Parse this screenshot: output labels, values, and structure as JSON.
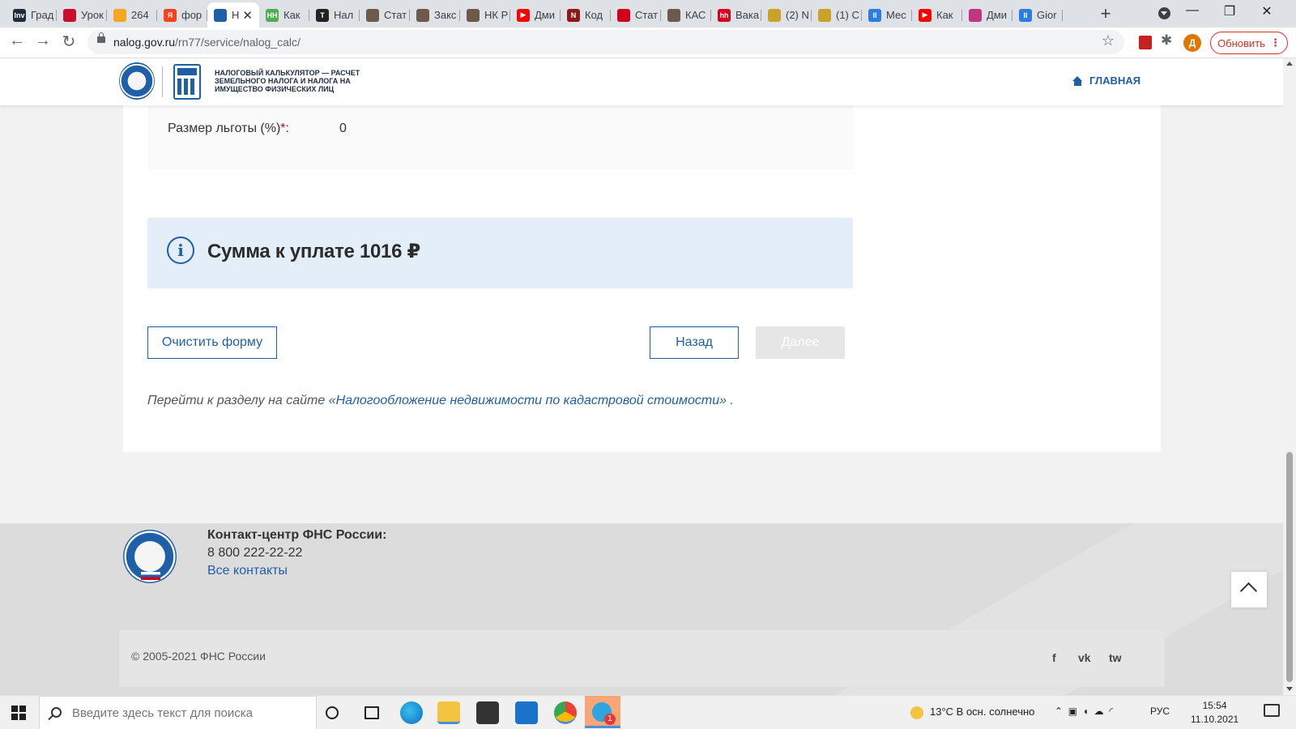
{
  "browser": {
    "tabs": [
      {
        "label": "Град",
        "favicon_text": "Inv",
        "color": "#1f2d3d"
      },
      {
        "label": "Урок",
        "favicon_text": "",
        "color": "#c8102e"
      },
      {
        "label": "264",
        "favicon_text": "",
        "color": "#f5a623"
      },
      {
        "label": "фор",
        "favicon_text": "Я",
        "color": "#fc3f1d"
      },
      {
        "label": "Н",
        "favicon_text": "",
        "color": "#1f5fa8"
      },
      {
        "label": "Как",
        "favicon_text": "HH",
        "color": "#4caf50"
      },
      {
        "label": "Нал",
        "favicon_text": "T",
        "color": "#222222"
      },
      {
        "label": "Стат",
        "favicon_text": "",
        "color": "#6e5a4b"
      },
      {
        "label": "Закс",
        "favicon_text": "",
        "color": "#6e5a4b"
      },
      {
        "label": "НК Р",
        "favicon_text": "",
        "color": "#6e5a4b"
      },
      {
        "label": "Дми",
        "favicon_text": "▶",
        "color": "#ff0000"
      },
      {
        "label": "Код",
        "favicon_text": "N",
        "color": "#8b1a1a"
      },
      {
        "label": "Стат",
        "favicon_text": "",
        "color": "#d0021b"
      },
      {
        "label": "КАС",
        "favicon_text": "",
        "color": "#6e5a4b"
      },
      {
        "label": "Вака",
        "favicon_text": "hh",
        "color": "#d6001c"
      },
      {
        "label": "(2) N",
        "favicon_text": "",
        "color": "#c9a227"
      },
      {
        "label": "(1) С",
        "favicon_text": "",
        "color": "#c9a227"
      },
      {
        "label": "Мес",
        "favicon_text": "II",
        "color": "#2a7de1"
      },
      {
        "label": "Как",
        "favicon_text": "▶",
        "color": "#ff0000"
      },
      {
        "label": "Дми",
        "favicon_text": "",
        "color": "#c13584"
      },
      {
        "label": "Gior",
        "favicon_text": "II",
        "color": "#2a7de1"
      }
    ],
    "url_host": "nalog.gov.ru",
    "url_path": "/rn77/service/nalog_calc/",
    "profile_initial": "Д",
    "update_label": "Обновить"
  },
  "header": {
    "title": "НАЛОГОВЫЙ КАЛЬКУЛЯТОР — РАСЧЕТ ЗЕМЕЛЬНОГО НАЛОГА И НАЛОГА НА ИМУЩЕСТВО ФИЗИЧЕСКИХ ЛИЦ",
    "home_link": "ГЛАВНАЯ"
  },
  "form": {
    "benefit_label": "Размер льготы (%)",
    "required_mark": "*",
    "benefit_value": "0",
    "result_text": "Сумма к уплате 1016 ₽",
    "clear_button": "Очистить форму",
    "back_button": "Назад",
    "next_button": "Далее",
    "goto_prefix": "Перейти к разделу на сайте ",
    "goto_link": "«Налогообложение недвижимости по кадастровой стоимости»",
    "goto_suffix": " ."
  },
  "footer": {
    "contact_title": "Контакт-центр ФНС России:",
    "phone": "8 800 222-22-22",
    "contacts_link": "Все контакты",
    "copyright": "© 2005-2021 ФНС России",
    "social": [
      "f",
      "vk",
      "tw"
    ]
  },
  "taskbar": {
    "search_placeholder": "Введите здесь текст для поиска",
    "weather": "13°C  В осн. солнечно",
    "language": "РУС",
    "time": "15:54",
    "date": "11.10.2021",
    "telegram_badge": "1"
  }
}
